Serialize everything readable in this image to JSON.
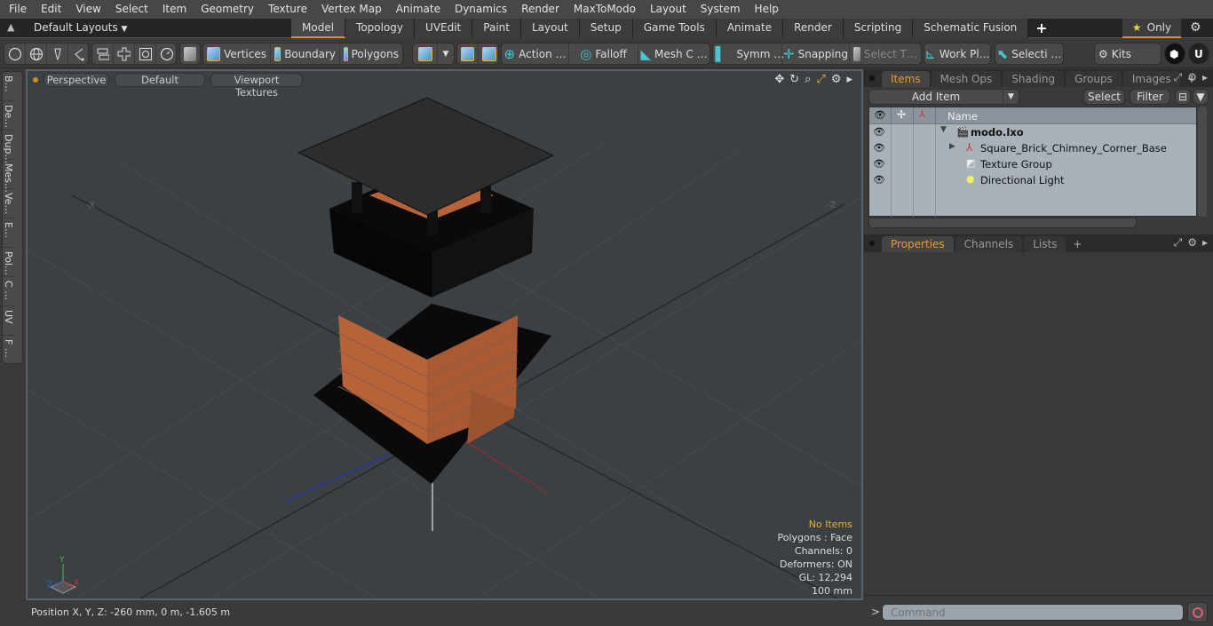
{
  "menubar": [
    "File",
    "Edit",
    "View",
    "Select",
    "Item",
    "Geometry",
    "Texture",
    "Vertex Map",
    "Animate",
    "Dynamics",
    "Render",
    "MaxToModo",
    "Layout",
    "System",
    "Help"
  ],
  "layoutbar": {
    "layouts_label": "Default Layouts",
    "tabs": [
      "Model",
      "Topology",
      "UVEdit",
      "Paint",
      "Layout",
      "Setup",
      "Game Tools",
      "Animate",
      "Render",
      "Scripting",
      "Schematic Fusion"
    ],
    "active_tab": "Model",
    "plus": "+",
    "only_label": "Only"
  },
  "toolbar": {
    "vertices": "Vertices",
    "boundary": "Boundary",
    "polygons": "Polygons",
    "action": "Action   …",
    "falloff": "Falloff",
    "mesh_c": "Mesh C …",
    "symm": "Symm …",
    "snapping": "Snapping",
    "select_t": "Select T…",
    "work_pl": "Work Pl…",
    "selecti": "Selecti …",
    "kits": "Kits"
  },
  "left_tabs": [
    "B…",
    "De…",
    "Dup…",
    "Mes…",
    "Ve…",
    "E…",
    "Pol…",
    "C …",
    "UV",
    "F …"
  ],
  "viewport": {
    "view_mode": "Perspective",
    "shading": "Default",
    "textures": "Viewport Textures",
    "axis_neg_x": "-X",
    "axis_neg_z": "-Z",
    "hud": {
      "selection": "No Items",
      "polygons": "Polygons : Face",
      "channels": "Channels: 0",
      "deformers": "Deformers: ON",
      "gl": "GL: 12,294",
      "unit": "100 mm"
    },
    "gizmo": {
      "y": "Y",
      "x": "X",
      "z": "Z"
    }
  },
  "status": {
    "position": "Position X, Y, Z:   -260 mm, 0 m, -1.605 m"
  },
  "items_panel": {
    "tabs": [
      "Items",
      "Mesh Ops",
      "Shading",
      "Groups",
      "Images"
    ],
    "active_tab": "Items",
    "add_item": "Add Item",
    "select": "Select",
    "filter": "Filter",
    "column_name": "Name",
    "rows": [
      {
        "name": "modo.lxo",
        "bold": true
      },
      {
        "name": "Square_Brick_Chimney_Corner_Base"
      },
      {
        "name": "Texture Group"
      },
      {
        "name": "Directional Light"
      }
    ]
  },
  "properties_panel": {
    "tabs": [
      "Properties",
      "Channels",
      "Lists"
    ],
    "active_tab": "Properties"
  },
  "command": {
    "prompt": ">",
    "placeholder": "Command"
  },
  "colors": {
    "accent": "#e0902c",
    "hud_orange": "#e6b23c",
    "viewport_bg": "#3b4045"
  }
}
